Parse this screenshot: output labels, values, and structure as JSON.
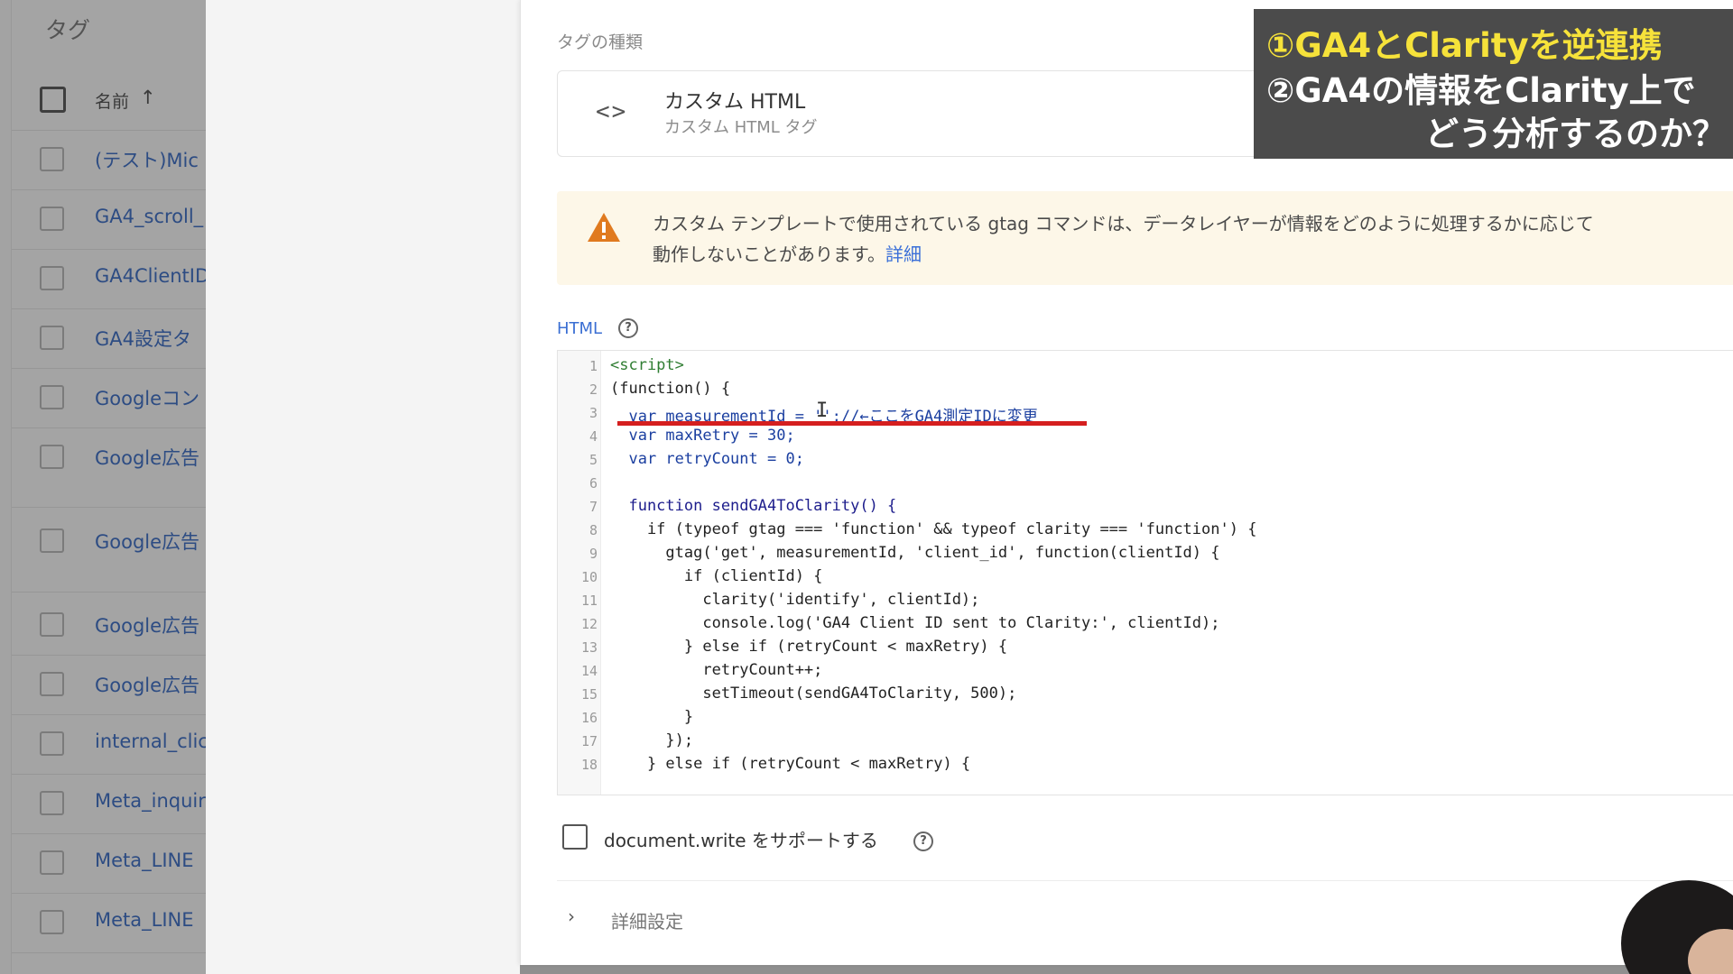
{
  "tag_list": {
    "title": "タグ",
    "column_name": "名前",
    "sort_icon": "arrow-up-icon",
    "rows": [
      "(テスト)Mic",
      "GA4_scroll_",
      "GA4ClientID",
      "GA4設定タ",
      "Googleコン",
      "Google広告",
      "Google広告",
      "Google広告",
      "Google広告",
      "internal_clic",
      "Meta_inquir",
      "Meta_LINE",
      "Meta_LINE"
    ]
  },
  "editor_panel": {
    "tag_type_label": "タグの種類",
    "tag_type": {
      "icon": "code-brackets-icon",
      "name": "カスタム HTML",
      "subtitle": "カスタム HTML タグ"
    },
    "warning": {
      "icon": "warning-triangle-icon",
      "line1": "カスタム テンプレートで使用されている gtag コマンドは、データレイヤーが情報をどのように処理するかに応じて",
      "line2": "動作しないことがあります。",
      "link": "詳細"
    },
    "html_label": "HTML",
    "help_icon": "question-circle-icon",
    "code_lines": [
      "<script>",
      "(function() {",
      "  var measurementId = '';//←ここをGA4測定IDに変更",
      "  var maxRetry = 30;",
      "  var retryCount = 0;",
      "",
      "  function sendGA4ToClarity() {",
      "    if (typeof gtag === 'function' && typeof clarity === 'function') {",
      "      gtag('get', measurementId, 'client_id', function(clientId) {",
      "        if (clientId) {",
      "          clarity('identify', clientId);",
      "          console.log('GA4 Client ID sent to Clarity:', clientId);",
      "        } else if (retryCount < maxRetry) {",
      "          retryCount++;",
      "          setTimeout(sendGA4ToClarity, 500);",
      "        }",
      "      });",
      "    } else if (retryCount < maxRetry) {"
    ],
    "line_numbers": [
      "1",
      "2",
      "3",
      "4",
      "5",
      "6",
      "7",
      "8",
      "9",
      "10",
      "11",
      "12",
      "13",
      "14",
      "15",
      "16",
      "17",
      "18"
    ],
    "docwrite_label": "document.write をサポートする",
    "advanced_label": "詳細設定",
    "chevron_icon": "chevron-right-icon"
  },
  "caption": {
    "line1": "①GA4とClarityを逆連携",
    "line2": "②GA4の情報をClarity上で",
    "line3": "どう分析するのか？"
  },
  "colors": {
    "accent_blue": "#3b6fd3",
    "warning_bg": "#fdf7e8",
    "highlight_red": "#d51f1f",
    "caption_yellow": "#f6e23a"
  }
}
